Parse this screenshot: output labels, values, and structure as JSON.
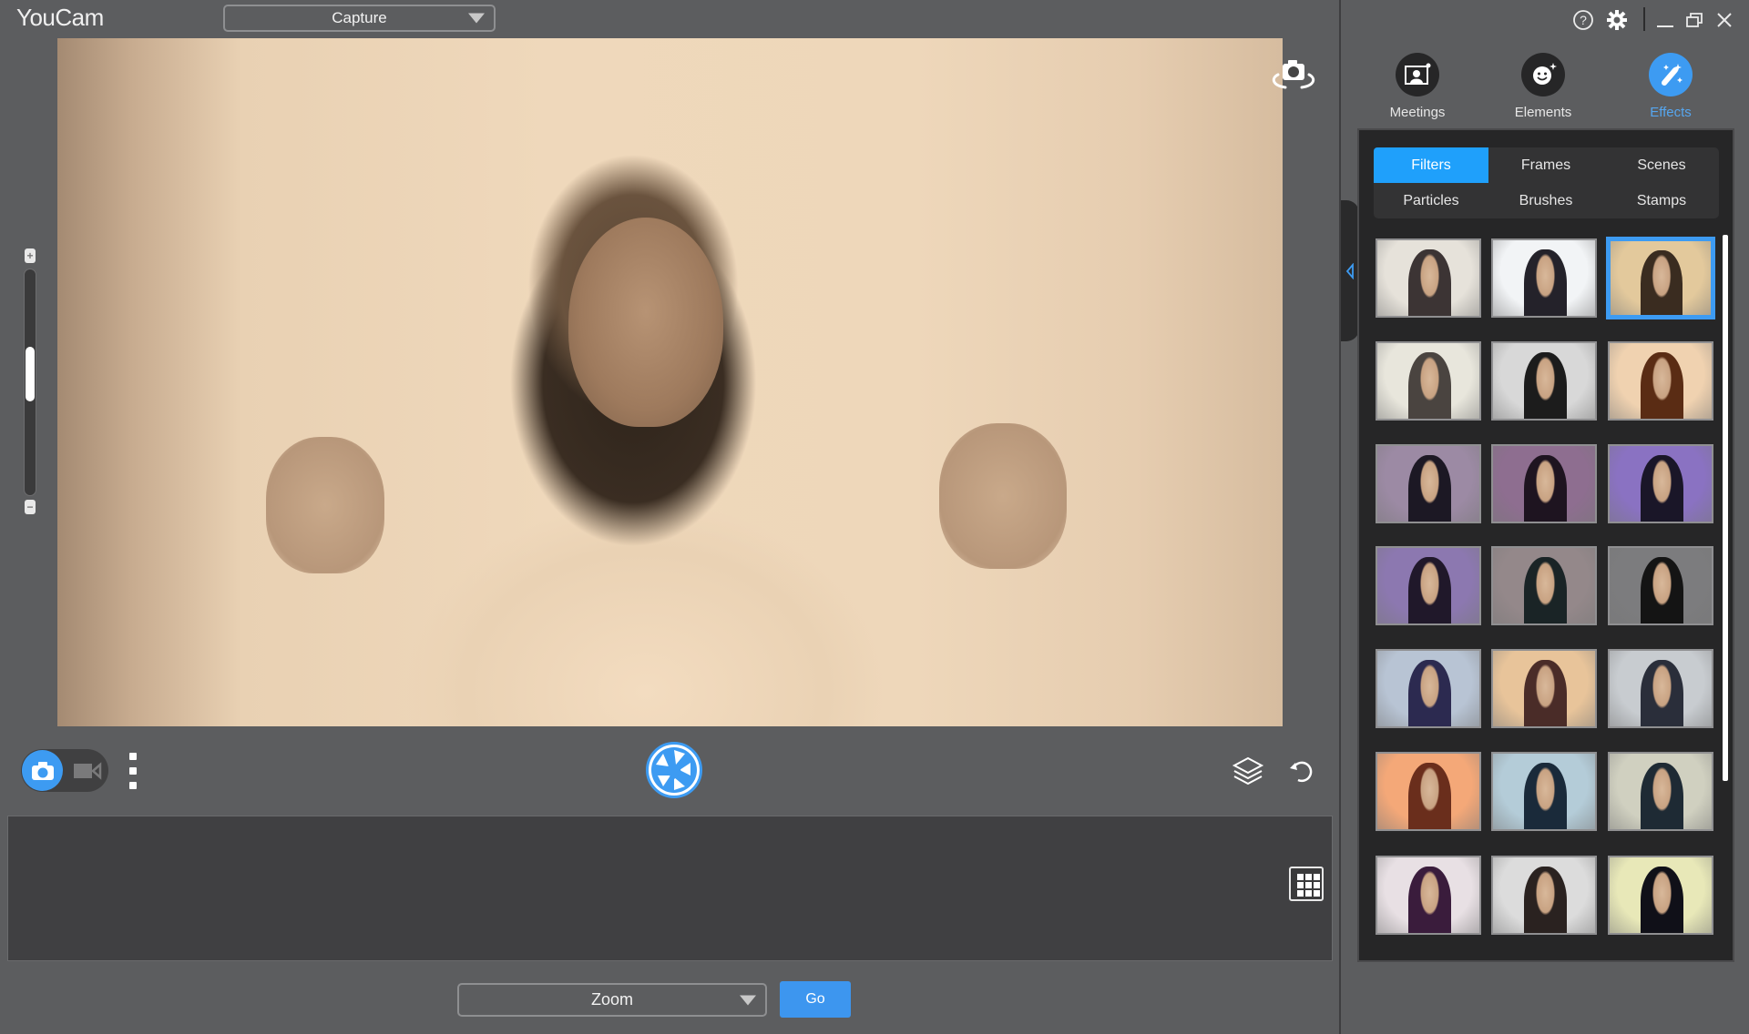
{
  "app": {
    "title": "YouCam",
    "mode_dropdown": {
      "value": "Capture"
    }
  },
  "window_controls": {
    "help": "help-icon",
    "settings": "gear-icon",
    "minimize": "minimize-icon",
    "restore": "restore-icon",
    "close": "close-icon"
  },
  "zoom_slider": {
    "plus": "+",
    "minus": "−",
    "level_fraction": 0.55
  },
  "toolbar": {
    "capture_mode": "photo",
    "more_icon": "more-vertical-icon",
    "shutter_icon": "shutter-icon",
    "layers_icon": "layers-icon",
    "undo_icon": "undo-icon",
    "grid_icon": "grid-icon"
  },
  "bottom": {
    "app_dropdown": {
      "value": "Zoom"
    },
    "go_label": "Go"
  },
  "modules": [
    {
      "label": "Meetings",
      "icon": "meetings-icon",
      "active": false
    },
    {
      "label": "Elements",
      "icon": "elements-icon",
      "active": false
    },
    {
      "label": "Effects",
      "icon": "effects-wand-icon",
      "active": true
    }
  ],
  "tabs": [
    {
      "label": "Filters",
      "active": true
    },
    {
      "label": "Frames",
      "active": false
    },
    {
      "label": "Scenes",
      "active": false
    },
    {
      "label": "Particles",
      "active": false
    },
    {
      "label": "Brushes",
      "active": false
    },
    {
      "label": "Stamps",
      "active": false
    }
  ],
  "filters": {
    "selected_index": 2,
    "thumbnails": [
      {
        "subject": "woman-long-hair",
        "tone": "#e6e2da",
        "fig": "#3c3434"
      },
      {
        "subject": "woman-long-hair",
        "tone": "#f2f4f6",
        "fig": "#24222a"
      },
      {
        "subject": "woman-long-hair",
        "tone": "#e3c99c",
        "fig": "#3a2c20"
      },
      {
        "subject": "woman-long-hair",
        "tone": "#e8e6dc",
        "fig": "#4a4440"
      },
      {
        "subject": "woman-long-hair",
        "tone": "#d8d8d8",
        "fig": "#1c1c1c"
      },
      {
        "subject": "woman-long-hair",
        "tone": "#f0d2b0",
        "fig": "#5a2c14"
      },
      {
        "subject": "woman-curly-hair",
        "tone": "#9c8aa4",
        "fig": "#1c1824"
      },
      {
        "subject": "woman-curly-hair",
        "tone": "#8e6e90",
        "fig": "#1e1420"
      },
      {
        "subject": "woman-curly-hair",
        "tone": "#8a72c2",
        "fig": "#1a1628"
      },
      {
        "subject": "woman-curly-hair",
        "tone": "#8c78b0",
        "fig": "#20182a"
      },
      {
        "subject": "woman-curly-hair",
        "tone": "#94888a",
        "fig": "#1a2426"
      },
      {
        "subject": "woman-curly-hair",
        "tone": "#7c7c7e",
        "fig": "#141414"
      },
      {
        "subject": "boy-portrait",
        "tone": "#b8c4d4",
        "fig": "#2c2a50"
      },
      {
        "subject": "boy-portrait",
        "tone": "#e8c49a",
        "fig": "#4a2c28"
      },
      {
        "subject": "boy-portrait",
        "tone": "#c8ccd0",
        "fig": "#2a2e3a"
      },
      {
        "subject": "boy-portrait",
        "tone": "#f4a878",
        "fig": "#6a2e1c"
      },
      {
        "subject": "boy-portrait",
        "tone": "#b4ccd8",
        "fig": "#1a2a3a"
      },
      {
        "subject": "boy-portrait",
        "tone": "#d0d0c0",
        "fig": "#1e2a34"
      },
      {
        "subject": "woman-hat",
        "tone": "#e8e0e4",
        "fig": "#3a1c3c"
      },
      {
        "subject": "woman-hat",
        "tone": "#dcdcdc",
        "fig": "#2a2220"
      },
      {
        "subject": "woman-hat",
        "tone": "#e8e8b8",
        "fig": "#101018"
      }
    ]
  },
  "colors": {
    "accent": "#3d9bf2",
    "tab_active": "#1fa0fb",
    "background": "#5c5d5f",
    "panel": "#262627"
  }
}
